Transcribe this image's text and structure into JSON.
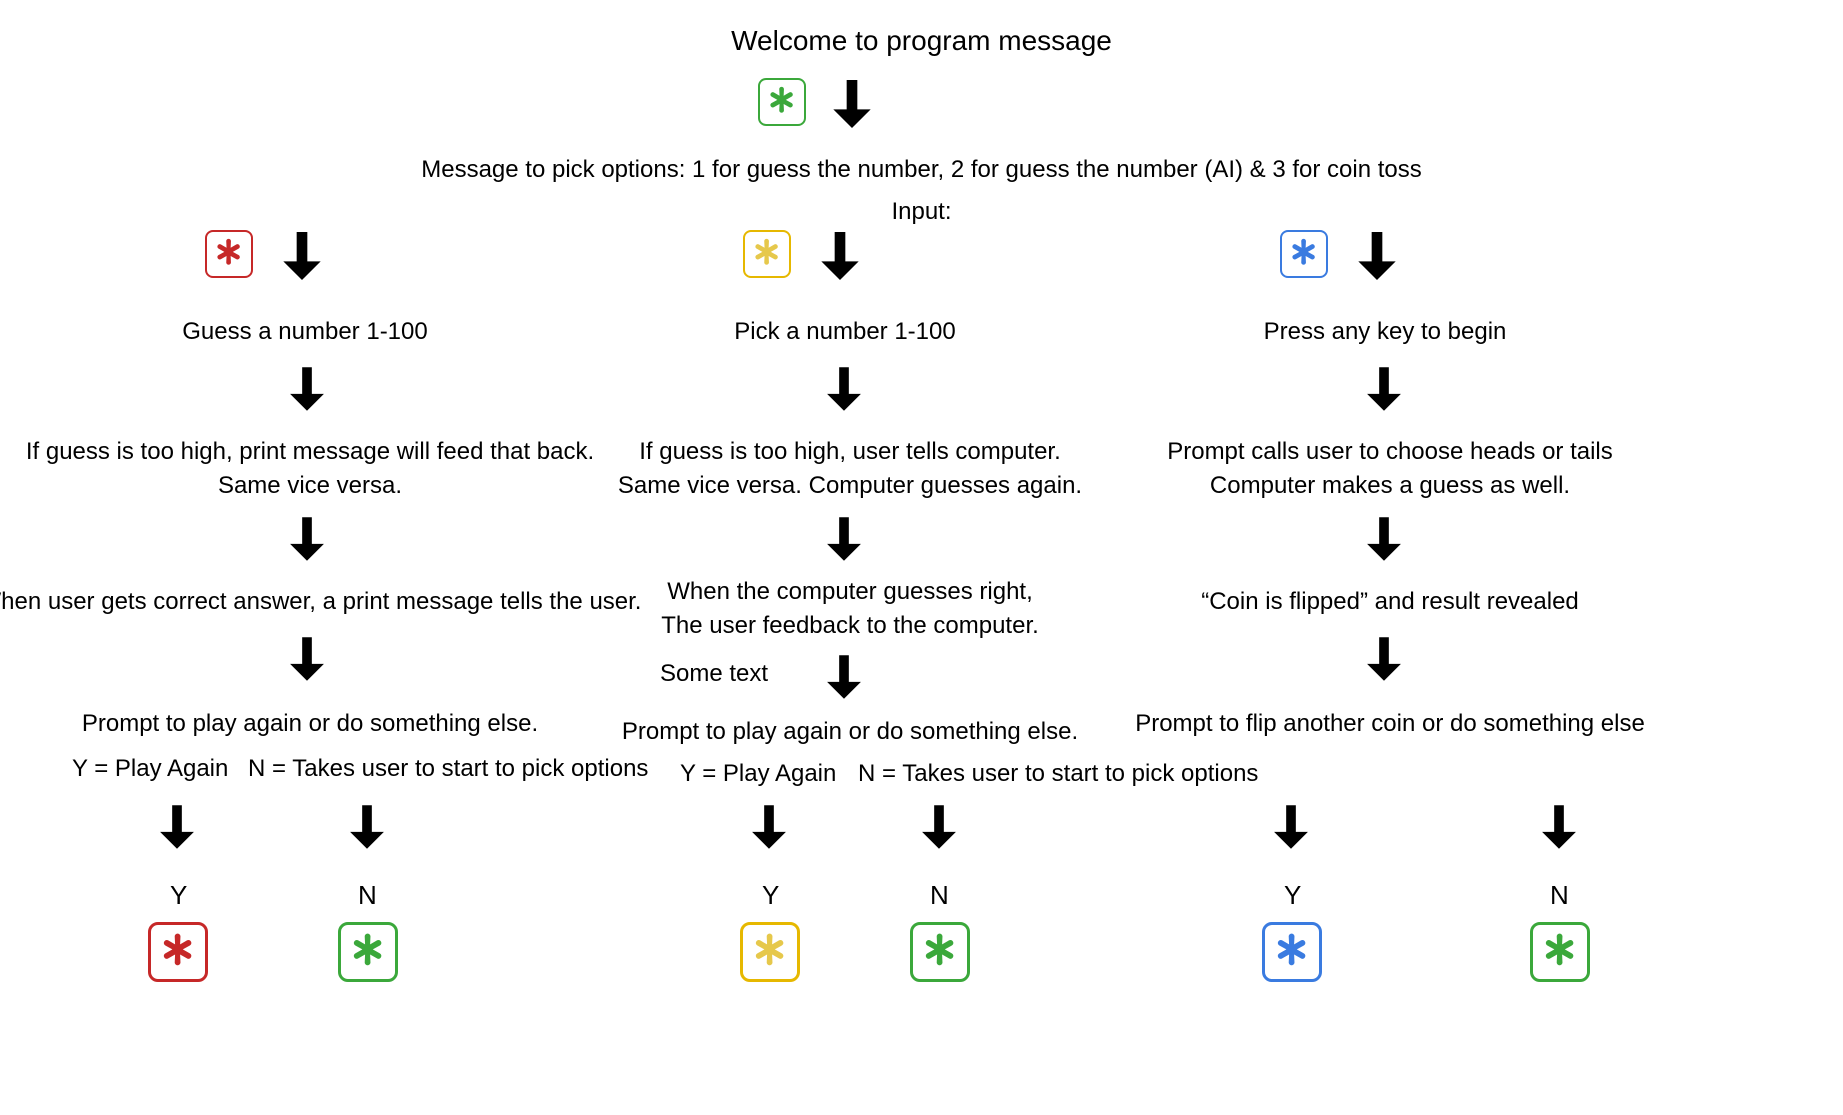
{
  "title": "Welcome to program message",
  "options_msg": "Message to pick options: 1 for guess the number, 2 for guess the number (AI) & 3 for coin toss",
  "input_label": "Input:",
  "branch1": {
    "header": "Guess a number 1-100",
    "step_a_line1": "If guess is too high, print message will feed that back.",
    "step_a_line2": "Same vice versa.",
    "step_b": "When user gets correct answer, a print message tells the user.",
    "prompt": "Prompt to play again or do something else.",
    "ylabel": "Y = Play Again",
    "nlabel": "N = Takes user to start to pick options",
    "Y": "Y",
    "N": "N"
  },
  "branch2": {
    "header": "Pick a number 1-100",
    "step_a_line1": "If guess is too high, user tells computer.",
    "step_a_line2": "Same vice versa. Computer guesses again.",
    "step_b_line1": "When the computer guesses right,",
    "step_b_line2": "The user feedback to the computer.",
    "sometext": "Some text",
    "prompt": "Prompt to play again or do something else.",
    "ylabel": "Y = Play Again",
    "nlabel": "N = Takes user to start to pick options",
    "Y": "Y",
    "N": "N"
  },
  "branch3": {
    "header": "Press any key to begin",
    "step_a_line1": "Prompt calls user to choose heads or tails",
    "step_a_line2": "Computer makes a guess as well.",
    "step_b": "“Coin is flipped” and result revealed",
    "prompt": "Prompt to flip another coin or do something else",
    "Y": "Y",
    "N": "N"
  }
}
